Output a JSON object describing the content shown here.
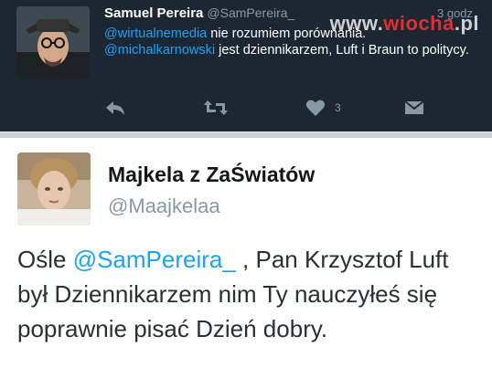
{
  "watermark": {
    "prefix": "www.",
    "brand": "wiocha",
    "suffix": ".pl"
  },
  "tweet1": {
    "author_name": "Samuel Pereira",
    "author_handle": "@SamPereira_",
    "time": "3 godz",
    "body": {
      "mention1": "@wirtualnemedia",
      "text1": " nie rozumiem porównania.",
      "mention2": "@michalkarnowski",
      "text2": " jest dziennikarzem, Luft i Braun to politycy."
    },
    "like_count": "3"
  },
  "tweet2": {
    "author_name": "Majkela z ZaŚwiatów",
    "author_handle": "@Maajkelaa",
    "body": {
      "text1": "Ośle ",
      "mention": "@SamPereira_",
      "text2": " , Pan Krzysztof Luft był Dziennikarzem nim Ty nauczyłeś się poprawnie pisać Dzień dobry."
    }
  },
  "icons": [
    "reply-icon",
    "retweet-icon",
    "heart-icon",
    "direct-message-icon"
  ],
  "colors": {
    "dark_bg": "#1c2733",
    "link": "#1da1f2",
    "muted": "#8899a6",
    "watermark_red": "#e0302e"
  }
}
